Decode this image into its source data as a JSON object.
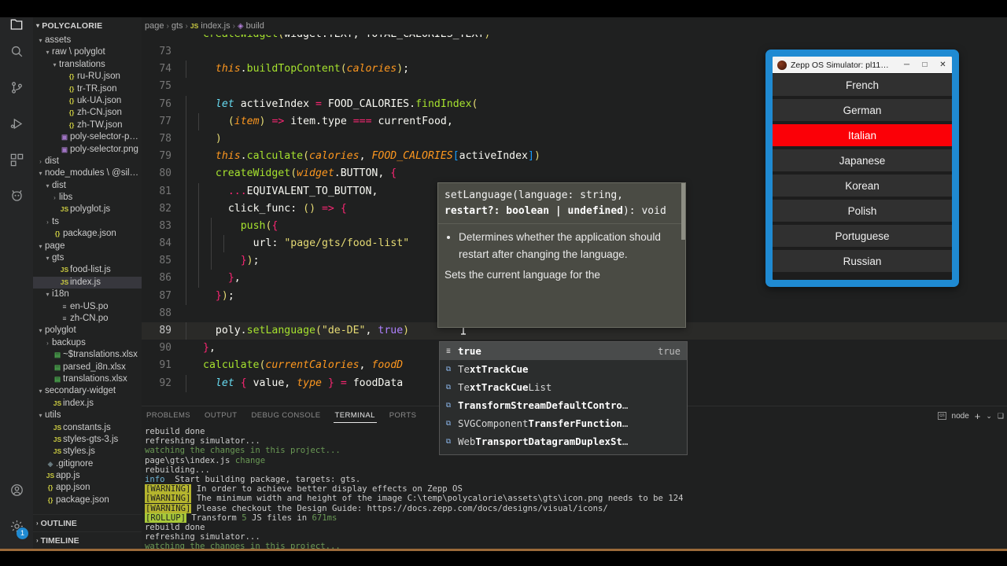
{
  "activitybar": {
    "items": [
      {
        "name": "explorer-icon",
        "label": "Explorer"
      },
      {
        "name": "search-icon",
        "label": "Search"
      },
      {
        "name": "source-control-icon",
        "label": "Source Control"
      },
      {
        "name": "run-debug-icon",
        "label": "Run and Debug"
      },
      {
        "name": "extensions-icon",
        "label": "Extensions"
      },
      {
        "name": "zepp-icon",
        "label": "Zepp OS"
      }
    ],
    "bottom": [
      {
        "name": "account-icon",
        "label": "Accounts"
      },
      {
        "name": "settings-gear-icon",
        "label": "Manage",
        "badge": "1"
      }
    ]
  },
  "sidebar": {
    "title": "POLYCALORIE",
    "tree": [
      {
        "depth": 1,
        "twisty": "⌄",
        "icon": "",
        "iconClass": "",
        "label": "assets"
      },
      {
        "depth": 2,
        "twisty": "⌄",
        "icon": "",
        "iconClass": "",
        "label": "raw \\ polyglot"
      },
      {
        "depth": 3,
        "twisty": "⌄",
        "icon": "",
        "iconClass": "",
        "label": "translations"
      },
      {
        "depth": 4,
        "twisty": "",
        "icon": "{}",
        "iconClass": "ic-json",
        "label": "ru-RU.json"
      },
      {
        "depth": 4,
        "twisty": "",
        "icon": "{}",
        "iconClass": "ic-json",
        "label": "tr-TR.json"
      },
      {
        "depth": 4,
        "twisty": "",
        "icon": "{}",
        "iconClass": "ic-json",
        "label": "uk-UA.json"
      },
      {
        "depth": 4,
        "twisty": "",
        "icon": "{}",
        "iconClass": "ic-json",
        "label": "zh-CN.json"
      },
      {
        "depth": 4,
        "twisty": "",
        "icon": "{}",
        "iconClass": "ic-json",
        "label": "zh-TW.json"
      },
      {
        "depth": 3,
        "twisty": "",
        "icon": "▣",
        "iconClass": "ic-png",
        "label": "poly-selector-press.png"
      },
      {
        "depth": 3,
        "twisty": "",
        "icon": "▣",
        "iconClass": "ic-png",
        "label": "poly-selector.png"
      },
      {
        "depth": 1,
        "twisty": "›",
        "icon": "",
        "iconClass": "",
        "label": "dist"
      },
      {
        "depth": 1,
        "twisty": "⌄",
        "icon": "",
        "iconClass": "",
        "label": "node_modules \\ @silver-…"
      },
      {
        "depth": 2,
        "twisty": "⌄",
        "icon": "",
        "iconClass": "",
        "label": "dist"
      },
      {
        "depth": 3,
        "twisty": "›",
        "icon": "",
        "iconClass": "",
        "label": "libs"
      },
      {
        "depth": 3,
        "twisty": "",
        "icon": "JS",
        "iconClass": "ic-js",
        "label": "polyglot.js"
      },
      {
        "depth": 2,
        "twisty": "›",
        "icon": "",
        "iconClass": "",
        "label": "ts"
      },
      {
        "depth": 2,
        "twisty": "",
        "icon": "{}",
        "iconClass": "ic-json",
        "label": "package.json"
      },
      {
        "depth": 1,
        "twisty": "⌄",
        "icon": "",
        "iconClass": "",
        "label": "page"
      },
      {
        "depth": 2,
        "twisty": "⌄",
        "icon": "",
        "iconClass": "",
        "label": "gts"
      },
      {
        "depth": 3,
        "twisty": "",
        "icon": "JS",
        "iconClass": "ic-js",
        "label": "food-list.js"
      },
      {
        "depth": 3,
        "twisty": "",
        "icon": "JS",
        "iconClass": "ic-js",
        "label": "index.js",
        "selected": true
      },
      {
        "depth": 2,
        "twisty": "⌄",
        "icon": "",
        "iconClass": "",
        "label": "i18n"
      },
      {
        "depth": 3,
        "twisty": "",
        "icon": "≡",
        "iconClass": "ic-po",
        "label": "en-US.po"
      },
      {
        "depth": 3,
        "twisty": "",
        "icon": "≡",
        "iconClass": "ic-po",
        "label": "zh-CN.po"
      },
      {
        "depth": 1,
        "twisty": "⌄",
        "icon": "",
        "iconClass": "",
        "label": "polyglot"
      },
      {
        "depth": 2,
        "twisty": "›",
        "icon": "",
        "iconClass": "",
        "label": "backups"
      },
      {
        "depth": 2,
        "twisty": "",
        "icon": "▤",
        "iconClass": "ic-xlsx",
        "label": "~$translations.xlsx"
      },
      {
        "depth": 2,
        "twisty": "",
        "icon": "▤",
        "iconClass": "ic-xlsx",
        "label": "parsed_i8n.xlsx"
      },
      {
        "depth": 2,
        "twisty": "",
        "icon": "▤",
        "iconClass": "ic-xlsx",
        "label": "translations.xlsx"
      },
      {
        "depth": 1,
        "twisty": "⌄",
        "icon": "",
        "iconClass": "",
        "label": "secondary-widget"
      },
      {
        "depth": 2,
        "twisty": "",
        "icon": "JS",
        "iconClass": "ic-js",
        "label": "index.js"
      },
      {
        "depth": 1,
        "twisty": "⌄",
        "icon": "",
        "iconClass": "",
        "label": "utils"
      },
      {
        "depth": 2,
        "twisty": "",
        "icon": "JS",
        "iconClass": "ic-js",
        "label": "constants.js"
      },
      {
        "depth": 2,
        "twisty": "",
        "icon": "JS",
        "iconClass": "ic-js",
        "label": "styles-gts-3.js"
      },
      {
        "depth": 2,
        "twisty": "",
        "icon": "JS",
        "iconClass": "ic-js",
        "label": "styles.js"
      },
      {
        "depth": 1,
        "twisty": "",
        "icon": "◈",
        "iconClass": "ic-git",
        "label": ".gitignore"
      },
      {
        "depth": 1,
        "twisty": "",
        "icon": "JS",
        "iconClass": "ic-js",
        "label": "app.js"
      },
      {
        "depth": 1,
        "twisty": "",
        "icon": "{}",
        "iconClass": "ic-json",
        "label": "app.json"
      },
      {
        "depth": 1,
        "twisty": "",
        "icon": "{}",
        "iconClass": "ic-json",
        "label": "package.json"
      }
    ],
    "bottom_sections": [
      {
        "label": "OUTLINE",
        "twisty": "›"
      },
      {
        "label": "TIMELINE",
        "twisty": "›"
      }
    ]
  },
  "breadcrumb": {
    "items": [
      "page",
      "gts",
      "index.js",
      "build"
    ],
    "separator": "›"
  },
  "editor": {
    "cursor_line": 89,
    "lines": [
      {
        "n": "72",
        "partial": true
      },
      {
        "n": "73",
        "text": ""
      },
      {
        "n": "74",
        "text": "  this.buildTopContent(calories);"
      },
      {
        "n": "75",
        "text": ""
      },
      {
        "n": "76",
        "text": "  let activeIndex = FOOD_CALORIES.findIndex("
      },
      {
        "n": "77",
        "text": "    (item) => item.type === currentFood,"
      },
      {
        "n": "78",
        "text": "  )"
      },
      {
        "n": "79",
        "text": "  this.calculate(calories, FOOD_CALORIES[activeIndex])"
      },
      {
        "n": "80",
        "text": "  createWidget(widget.BUTTON, {"
      },
      {
        "n": "81",
        "text": "    ...EQUIVALENT_TO_BUTTON,"
      },
      {
        "n": "82",
        "text": "    click_func: () => {"
      },
      {
        "n": "83",
        "text": "      push({"
      },
      {
        "n": "84",
        "text": "        url: \"page/gts/food-list\""
      },
      {
        "n": "85",
        "text": "      });"
      },
      {
        "n": "86",
        "text": "    },"
      },
      {
        "n": "87",
        "text": "  });"
      },
      {
        "n": "88",
        "text": ""
      },
      {
        "n": "89",
        "text": "  poly.setLanguage(\"de-DE\", true)"
      },
      {
        "n": "90",
        "text": "},"
      },
      {
        "n": "91",
        "text": "calculate(currentCalories, foodD"
      },
      {
        "n": "92",
        "text": "  let { value, type } = foodData"
      }
    ]
  },
  "hover": {
    "signature_1": "setLanguage(language: string,",
    "signature_2": "restart?: boolean | undefined",
    "signature_3": "): void",
    "bullet": "Determines whether the application should restart after changing the language.",
    "paragraph": "Sets the current language for the"
  },
  "suggest": {
    "items": [
      {
        "icon": "≣",
        "iconkind": "keyword",
        "pre": "",
        "bold": "true",
        "post": "",
        "right": "true",
        "selected": true
      },
      {
        "icon": "⧉",
        "iconkind": "class",
        "pre": "Te",
        "bold": "xtTrackCue",
        "post": "",
        "right": "",
        "selected": false
      },
      {
        "icon": "⧉",
        "iconkind": "class",
        "pre": "Te",
        "bold": "xtTrackCue",
        "post": "List",
        "right": "",
        "selected": false
      },
      {
        "icon": "⧉",
        "iconkind": "class",
        "pre": "",
        "bold": "TransformStreamDefaultContro",
        "post": "…",
        "right": "",
        "selected": false
      },
      {
        "icon": "⧉",
        "iconkind": "class",
        "pre": "SVGComponent",
        "bold": "TransferFunction",
        "post": "…",
        "right": "",
        "selected": false
      },
      {
        "icon": "⧉",
        "iconkind": "class",
        "pre": "Web",
        "bold": "TransportDatagramDuplexSt",
        "post": "…",
        "right": "",
        "selected": false
      }
    ]
  },
  "panel": {
    "tabs": [
      {
        "label": "PROBLEMS",
        "active": false
      },
      {
        "label": "OUTPUT",
        "active": false
      },
      {
        "label": "DEBUG CONSOLE",
        "active": false
      },
      {
        "label": "TERMINAL",
        "active": true
      },
      {
        "label": "PORTS",
        "active": false
      }
    ],
    "actions": {
      "shell_badge": "cn",
      "shell_label": "node",
      "new_terminal": "+",
      "chevron": "⌄",
      "split": "❑"
    },
    "terminal_lines": [
      [
        {
          "t": "rebuild done",
          "c": "plain"
        }
      ],
      [
        {
          "t": "refreshing simulator...",
          "c": "plain"
        }
      ],
      [
        {
          "t": "watching the changes in this project...",
          "c": "green"
        }
      ],
      [
        {
          "t": "page\\gts\\index.js ",
          "c": "plain"
        },
        {
          "t": "change",
          "c": "green"
        }
      ],
      [
        {
          "t": "rebuilding...",
          "c": "plain"
        }
      ],
      [
        {
          "t": "info",
          "c": "blue"
        },
        {
          "t": "  Start building package, targets: gts.",
          "c": "plain"
        }
      ],
      [
        {
          "t": "[WARNING]",
          "c": "warn"
        },
        {
          "t": " In order to achieve better display effects on Zepp OS",
          "c": "plain"
        }
      ],
      [
        {
          "t": "[WARNING]",
          "c": "warn"
        },
        {
          "t": " The minimum width and height of the image C:\\temp\\polycalorie\\assets\\gts\\icon.png needs to be 124",
          "c": "plain"
        }
      ],
      [
        {
          "t": "[WARNING]",
          "c": "warn"
        },
        {
          "t": " Please checkout the Design Guide: https://docs.zepp.com/docs/designs/visual/icons/",
          "c": "plain"
        }
      ],
      [
        {
          "t": "[ROLLUP]",
          "c": "roll"
        },
        {
          "t": " Transform ",
          "c": "plain"
        },
        {
          "t": "5",
          "c": "green"
        },
        {
          "t": " JS files in ",
          "c": "plain"
        },
        {
          "t": "671ms",
          "c": "green"
        }
      ],
      [
        {
          "t": "rebuild done",
          "c": "plain"
        }
      ],
      [
        {
          "t": "refreshing simulator...",
          "c": "plain"
        }
      ],
      [
        {
          "t": "watching the changes in this project...",
          "c": "green"
        }
      ],
      [
        {
          "t": "█",
          "c": "plain"
        }
      ]
    ]
  },
  "simulator": {
    "title": "Zepp OS Simulator: pl11…",
    "window_buttons": {
      "minimize": "─",
      "maximize": "□",
      "close": "✕"
    },
    "accent": "#1f8ad2",
    "active_color": "#fb0007",
    "languages": [
      {
        "label": "French",
        "active": false
      },
      {
        "label": "German",
        "active": false
      },
      {
        "label": "Italian",
        "active": true
      },
      {
        "label": "Japanese",
        "active": false
      },
      {
        "label": "Korean",
        "active": false
      },
      {
        "label": "Polish",
        "active": false
      },
      {
        "label": "Portuguese",
        "active": false
      },
      {
        "label": "Russian",
        "active": false
      }
    ]
  },
  "statusbar": {
    "color": "#9b6a3a"
  }
}
